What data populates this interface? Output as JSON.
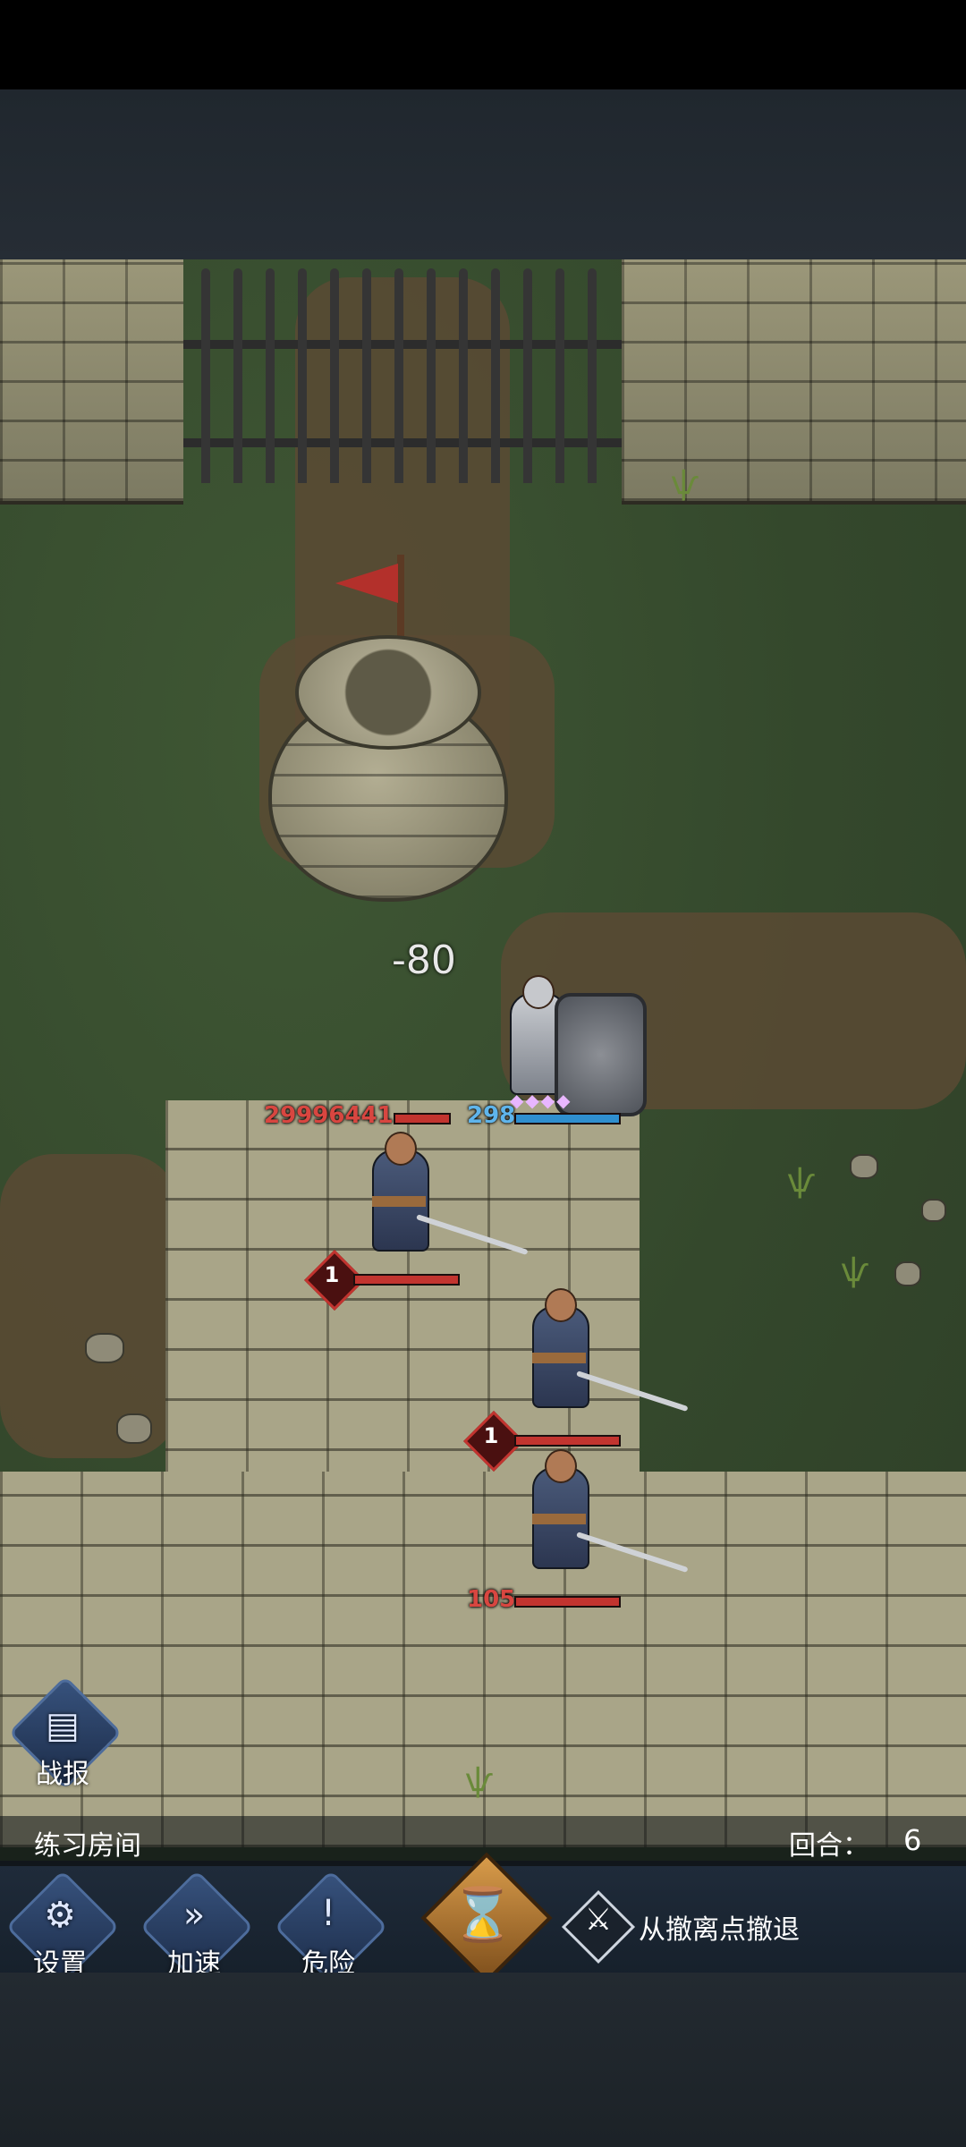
{
  "battle": {
    "boss_hp": "29996441",
    "hero_hp": "298",
    "damage_popup": "-80",
    "enemy_badges": [
      "1",
      "1"
    ],
    "enemy_hp": "105"
  },
  "hud": {
    "report_label": "战报",
    "room_name": "练习房间",
    "round_label": "回合：",
    "round_value": "6",
    "settings_label": "设置",
    "speed_label": "加速",
    "danger_label": "危险",
    "retreat_label": "从撤离点撤退"
  },
  "icons": {
    "report": "document-icon",
    "settings": "gear-icon",
    "speed": "fast-forward-icon",
    "danger": "exclamation-icon",
    "end_turn": "hourglass-icon",
    "retreat": "crossed-swords-icon"
  },
  "colors": {
    "enemy_hp": "#c2342f",
    "hero_hp": "#2f8fcf",
    "button_blue": "#37527d",
    "button_gold": "#d89b4a"
  }
}
